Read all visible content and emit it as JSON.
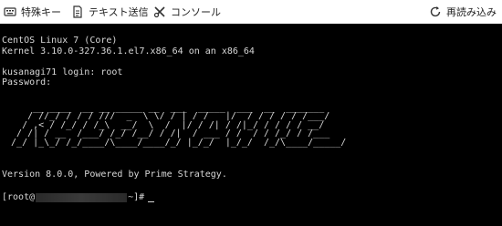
{
  "toolbar": {
    "special_key_label": "特殊キー",
    "text_send_label": "テキスト送信",
    "console_label": "コンソール",
    "reload_label": "再読み込み"
  },
  "terminal": {
    "lines": [
      "CentOS Linux 7 (Core)",
      "Kernel 3.10.0-327.36.1.el7.x86_64 on an x86_64",
      "",
      "kusanagi71 login: root",
      "Password:"
    ],
    "banner_art": "      __ ____  __ __ _____ __  ___  _____  ___  __  _______\n     / //_/ / / / ///  _  \\ \\/ / | / /   |/  / / / / / /___/\n    / ,< / /_/ / /_\\  __/  \\  /  |/ / /| / /|_/ / / / / __/  \n   / /| / __  /___/ /_/ /__/ / /|  / ___ / /  / / /_/ / /___ \n  /_/ |_\\_/ /_/____/\\____/____/_/ |_/_/  |_/_/  /_/\\____/_____/ ",
    "version_line": "Version 8.0.0, Powered by Prime Strategy.",
    "prompt_prefix": "[root@",
    "prompt_suffix": "~]#"
  }
}
